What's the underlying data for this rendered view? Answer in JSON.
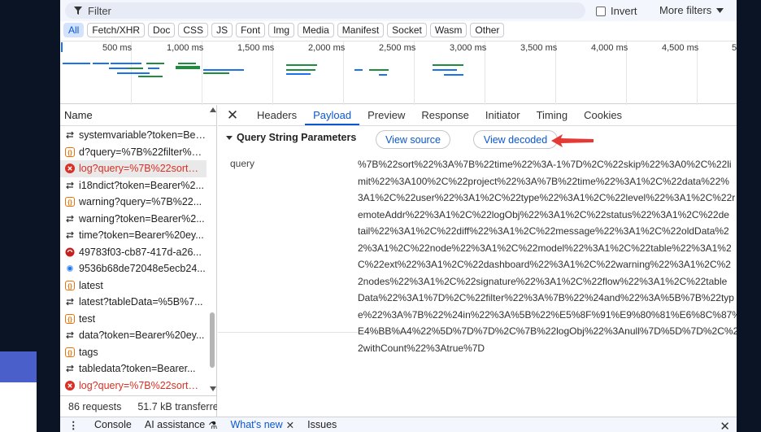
{
  "filter": {
    "placeholder": "Filter",
    "invert_label": "Invert",
    "more_filters_label": "More filters"
  },
  "type_chips": [
    "All",
    "Fetch/XHR",
    "Doc",
    "CSS",
    "JS",
    "Font",
    "Img",
    "Media",
    "Manifest",
    "Socket",
    "Wasm",
    "Other"
  ],
  "timeline": {
    "ticks": [
      "500 ms",
      "1,000 ms",
      "1,500 ms",
      "2,000 ms",
      "2,500 ms",
      "3,000 ms",
      "3,500 ms",
      "4,000 ms",
      "4,500 ms",
      "5"
    ]
  },
  "requests": {
    "column_header": "Name",
    "items": [
      {
        "label": "systemvariable?token=Bearer%2...",
        "icon": "fetch-icon",
        "status": "ok"
      },
      {
        "label": "d?query=%7B%22filter%22...",
        "icon": "script-icon",
        "status": "ok"
      },
      {
        "label": "log?query=%7B%22sort%22...",
        "icon": "error-icon",
        "status": "error"
      },
      {
        "label": "i18ndict?token=Bearer%2...",
        "icon": "fetch-icon",
        "status": "ok"
      },
      {
        "label": "warning?query=%7B%22...",
        "icon": "script-icon",
        "status": "ok"
      },
      {
        "label": "warning?token=Bearer%2...",
        "icon": "fetch-icon",
        "status": "ok"
      },
      {
        "label": "time?token=Bearer%20ey...",
        "icon": "fetch-icon",
        "status": "ok"
      },
      {
        "label": "49783f03-cb87-417d-a26...",
        "icon": "wasm-icon",
        "status": "ok"
      },
      {
        "label": "9536b68de72048e5ecb24...",
        "icon": "image-icon",
        "status": "ok"
      },
      {
        "label": "latest",
        "icon": "script-icon",
        "status": "ok"
      },
      {
        "label": "latest?tableData=%5B%7...",
        "icon": "fetch-icon",
        "status": "ok"
      },
      {
        "label": "test",
        "icon": "script-icon",
        "status": "ok"
      },
      {
        "label": "data?token=Bearer%20ey...",
        "icon": "fetch-icon",
        "status": "ok"
      },
      {
        "label": "tags",
        "icon": "script-icon",
        "status": "ok"
      },
      {
        "label": "tabledata?token=Bearer...",
        "icon": "fetch-icon",
        "status": "ok"
      },
      {
        "label": "log?query=%7B%22sort%22...",
        "icon": "error-icon",
        "status": "error"
      }
    ],
    "footer_count": "86 requests",
    "footer_transferred": "51.7 kB transferred"
  },
  "details": {
    "tabs": [
      "Headers",
      "Payload",
      "Preview",
      "Response",
      "Initiator",
      "Timing",
      "Cookies"
    ],
    "active_tab": "Payload",
    "section_title": "Query String Parameters",
    "view_source_label": "View source",
    "view_decoded_label": "View decoded",
    "param_key": "query",
    "param_value_lines": [
      "%7B%22sort%22%3A%7B%22time%22%3A-1%7D%2C%22skip%22%3A0%2C%22li",
      "mit%22%3A100%2C%22project%22%3A%7B%22time%22%3A1%2C%22data%22%",
      "3A1%2C%22user%22%3A1%2C%22type%22%3A1%2C%22level%22%3A1%2C%22r",
      "emoteAddr%22%3A1%2C%22logObj%22%3A1%2C%22status%22%3A1%2C%22de",
      "tail%22%3A1%2C%22diff%22%3A1%2C%22message%22%3A1%2C%22oldData%2",
      "2%3A1%2C%22node%22%3A1%2C%22model%22%3A1%2C%22table%22%3A1%2",
      "C%22ext%22%3A1%2C%22dashboard%22%3A1%2C%22warning%22%3A1%2C%2",
      "2nodes%22%3A1%2C%22signature%22%3A1%2C%22flow%22%3A1%2C%22table",
      "Data%22%3A1%7D%2C%22filter%22%3A%7B%22%24and%22%3A%5B%7B%22typ",
      "e%22%3A%7B%22%24in%22%3A%5B%22%E5%8F%91%E9%80%81%E6%8C%87%",
      "E4%BB%A4%22%5D%7D%7D%2C%7B%22logObj%22%3Anull%7D%5D%7D%2C%2",
      "2withCount%22%3Atrue%7D"
    ]
  },
  "drawer": {
    "tabs": [
      "Console",
      "AI assistance",
      "What's new",
      "Issues"
    ],
    "active_tab": "What's new"
  },
  "colors": {
    "accent": "#0b57d0",
    "error": "#d93025",
    "annotation_arrow": "#e53935"
  }
}
